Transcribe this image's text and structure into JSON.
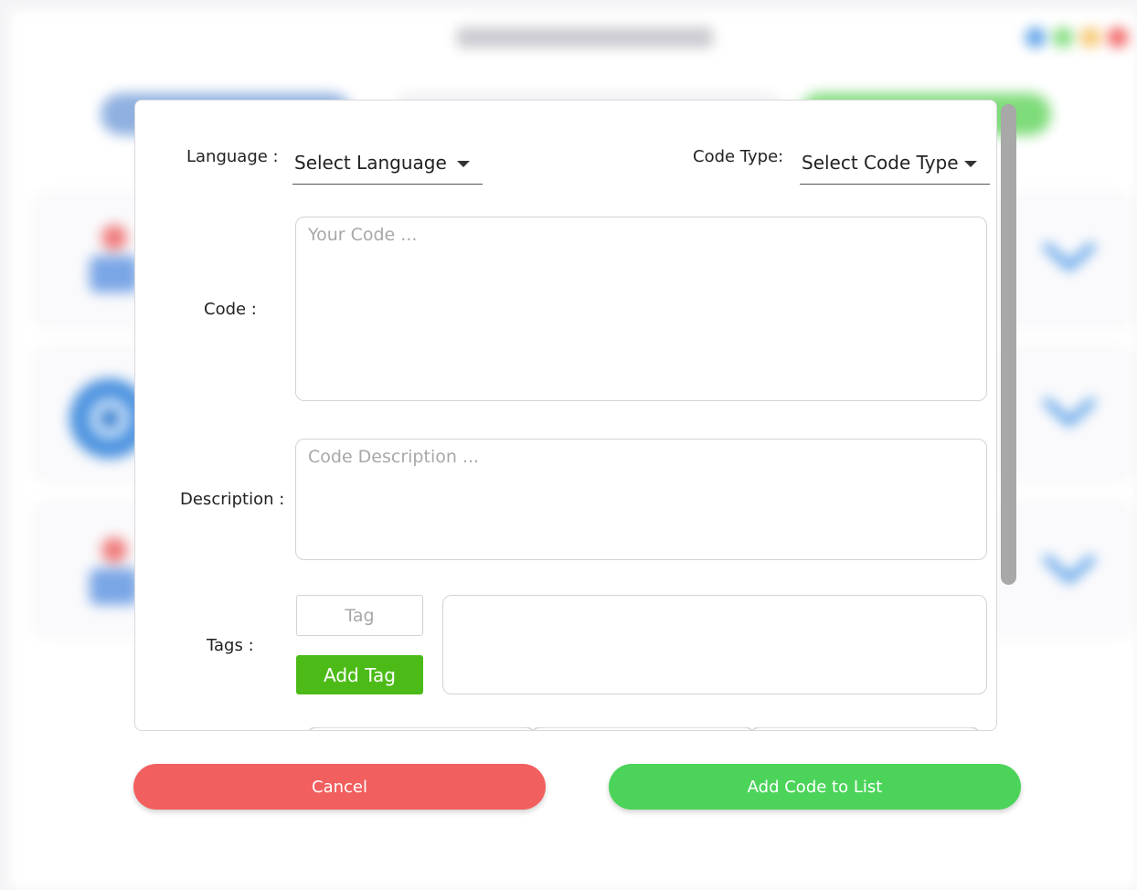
{
  "form": {
    "language_label": "Language :",
    "language_value": "Select Language",
    "code_type_label": "Code Type:",
    "code_type_value": "Select Code Type",
    "code_label": "Code :",
    "code_placeholder": "Your Code ...",
    "description_label": "Description :",
    "description_placeholder": "Code Description ...",
    "tags_label": "Tags  :",
    "tag_placeholder": "Tag",
    "add_tag_label": "Add Tag"
  },
  "actions": {
    "cancel_label": "Cancel",
    "add_code_label": "Add Code to List"
  },
  "colors": {
    "cancel": "#f25f5f",
    "add_code": "#4cd45a",
    "add_tag": "#4cbb17",
    "background_primary_button": "#8fb0e0",
    "background_add_button": "#7fdc7a",
    "background_accent_blue": "#5aa0e8"
  },
  "icons": [
    "chevron-down-icon",
    "caret-down-icon"
  ]
}
